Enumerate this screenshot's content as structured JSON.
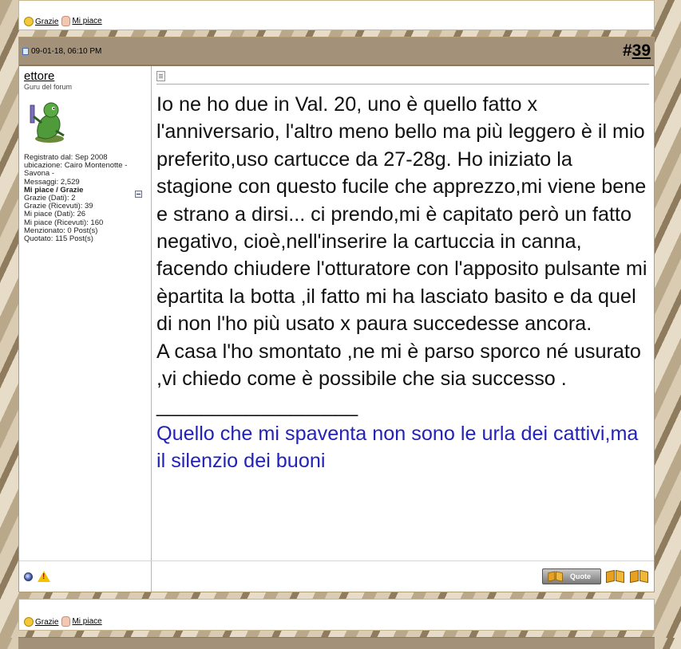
{
  "top_thanks": {
    "thanks_label": "Grazie",
    "like_label": "Mi piace"
  },
  "post": {
    "date": "09-01-18, 06:10 PM",
    "number_prefix": "#",
    "number": "39",
    "user": {
      "name": "ettore",
      "title": "Guru del forum",
      "stats": [
        "Registrato dal: Sep 2008",
        "ubicazione: Cairo Montenotte -",
        "Savona -",
        "Messaggi: 2,529",
        "Mi piace / Grazie",
        "Grazie (Dati): 2",
        "Grazie (Ricevuti): 39",
        "Mi piace (Dati): 26",
        "Mi piace (Ricevuti): 160",
        "Menzionato: 0 Post(s)",
        "Quotato: 115 Post(s)"
      ]
    },
    "message": [
      "Io ne ho due in Val. 20, uno è quello fatto x l'anniversario, l'altro meno bello ma più leggero è il mio preferito,uso cartucce da 27-28g. Ho iniziato la stagione con questo fucile che apprezzo,mi viene bene e strano a dirsi... ci prendo,mi è capitato però un fatto negativo, cioè,nell'inserire la cartuccia in canna, facendo chiudere l'otturatore con l'apposito pulsante mi èpartita la botta ,il fatto mi ha lasciato basito e da quel di non l'ho più usato x paura succedesse ancora.",
      "A casa l'ho smontato ,ne mi è parso sporco né usurato ,vi chiedo come è possibile che sia successo ."
    ],
    "signature_line": "__________________",
    "signature": "Quello che mi spaventa non sono le urla dei cattivi,ma il silenzio dei buoni",
    "quote_label": "Quote"
  },
  "bottom_thanks": {
    "thanks_label": "Grazie",
    "like_label": "Mi piace"
  },
  "colors": {
    "header_bg": "#a4917a",
    "signature": "#2323b8",
    "border": "#c8b48e"
  }
}
